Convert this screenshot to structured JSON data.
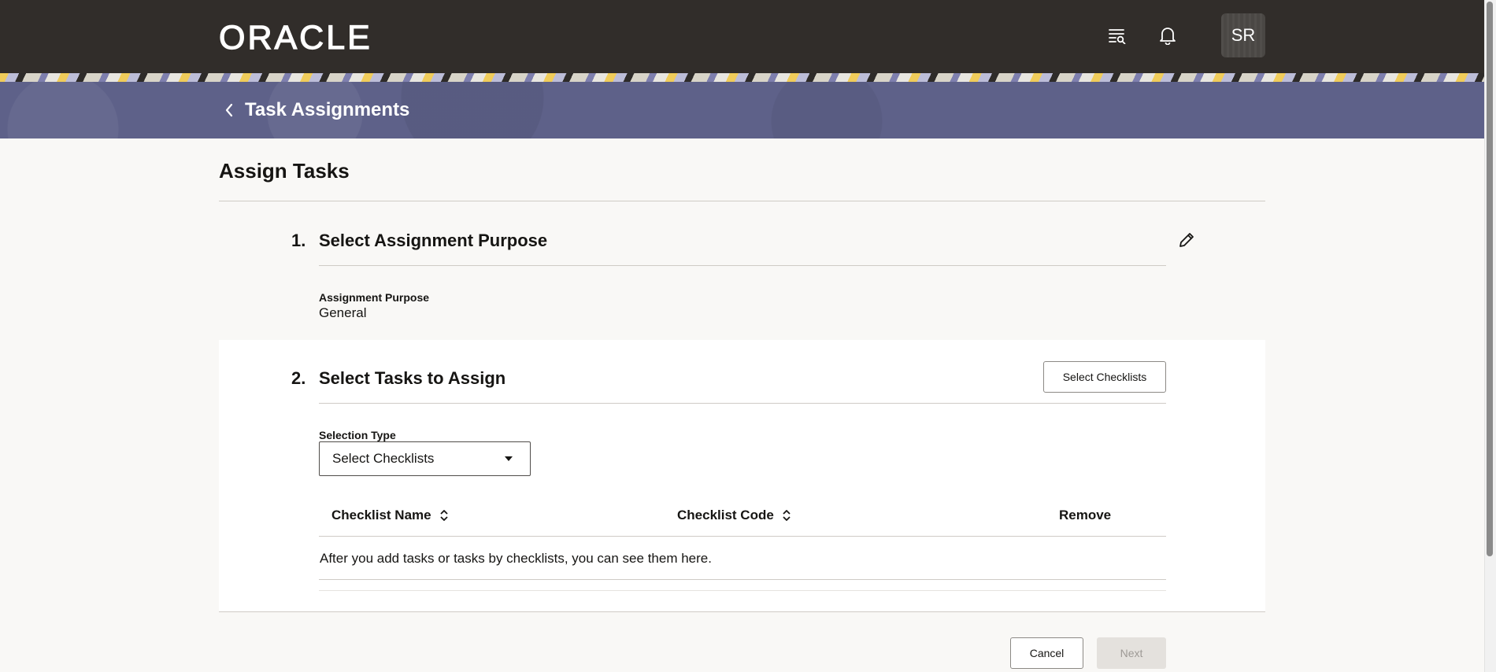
{
  "header": {
    "logo_text": "ORACLE",
    "icons": [
      "search-list-icon",
      "bell-icon"
    ],
    "avatar_initials": "SR"
  },
  "banner": {
    "title": "Task Assignments"
  },
  "page": {
    "title": "Assign Tasks"
  },
  "step1": {
    "number": "1.",
    "title": "Select Assignment Purpose",
    "field_label": "Assignment Purpose",
    "field_value": "General"
  },
  "step2": {
    "number": "2.",
    "title": "Select Tasks to Assign",
    "select_checklists_button": "Select Checklists",
    "selection_type_label": "Selection Type",
    "selection_type_value": "Select Checklists",
    "table": {
      "columns": [
        "Checklist Name",
        "Checklist Code",
        "Remove"
      ],
      "empty_message": "After you add tasks or tasks by checklists, you can see them here."
    }
  },
  "footer": {
    "cancel_label": "Cancel",
    "next_label": "Next"
  },
  "colors": {
    "header_bg": "#312d2a",
    "banner_bg": "#5e6189",
    "page_bg": "#f9f8f6"
  }
}
